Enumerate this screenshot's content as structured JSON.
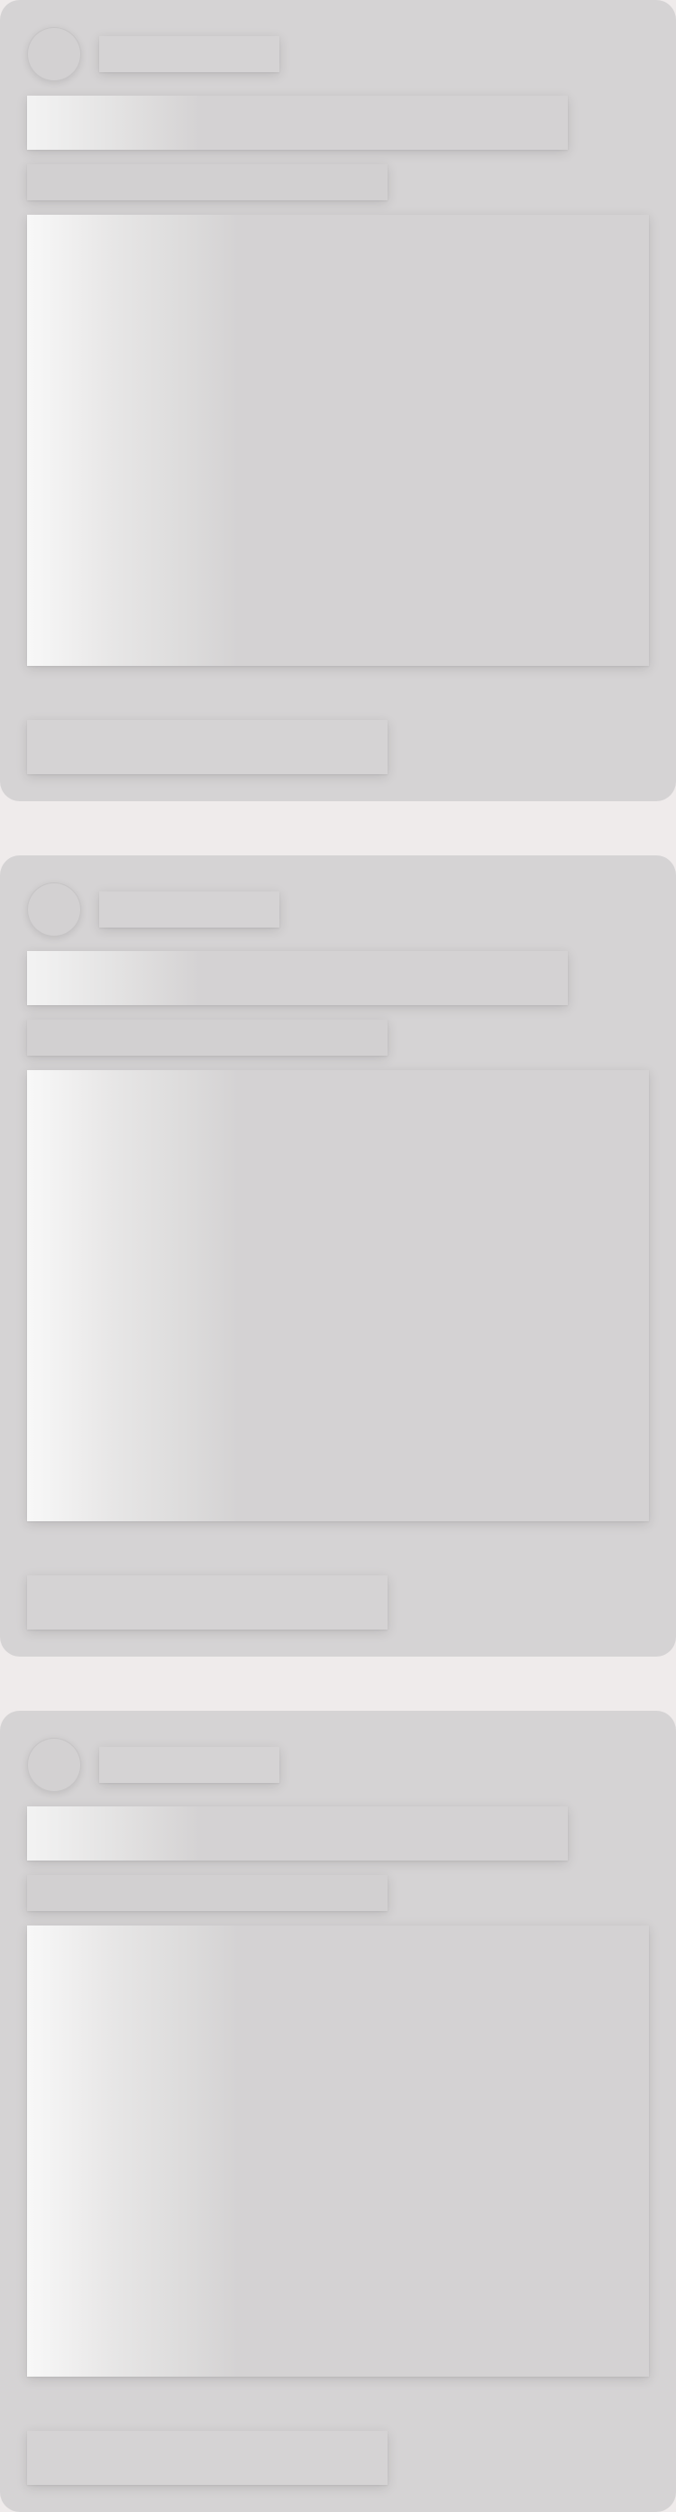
{
  "page": {
    "state": "loading",
    "background_color": "#efebeb"
  },
  "colors": {
    "card": "#d5d3d4",
    "shimmer_highlight": "#f8f8f8"
  },
  "feed": {
    "cards": [
      {
        "placeholders": [
          "avatar",
          "name",
          "title",
          "subtitle",
          "media",
          "footer"
        ]
      },
      {
        "placeholders": [
          "avatar",
          "name",
          "title",
          "subtitle",
          "media",
          "footer"
        ]
      },
      {
        "placeholders": [
          "avatar",
          "name",
          "title",
          "subtitle",
          "media",
          "footer"
        ]
      }
    ]
  }
}
